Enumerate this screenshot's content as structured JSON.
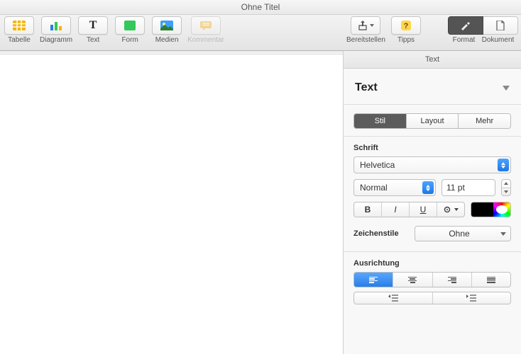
{
  "window": {
    "title": "Ohne Titel"
  },
  "toolbar": {
    "items": [
      {
        "label": "Tabelle"
      },
      {
        "label": "Diagramm"
      },
      {
        "label": "Text"
      },
      {
        "label": "Form"
      },
      {
        "label": "Medien"
      },
      {
        "label": "Kommentar"
      }
    ],
    "share": {
      "label": "Bereitstellen"
    },
    "tips": {
      "label": "Tipps"
    },
    "format": {
      "label": "Format"
    },
    "document": {
      "label": "Dokument"
    }
  },
  "inspector": {
    "header": "Text",
    "style": {
      "title": "Text",
      "tabs": {
        "stil": "Stil",
        "layout": "Layout",
        "mehr": "Mehr"
      },
      "font_section": "Schrift",
      "font_family": "Helvetica",
      "font_weight": "Normal",
      "font_size": "11 pt",
      "charstyle_label": "Zeichenstile",
      "charstyle_value": "Ohne",
      "alignment_label": "Ausrichtung"
    }
  }
}
